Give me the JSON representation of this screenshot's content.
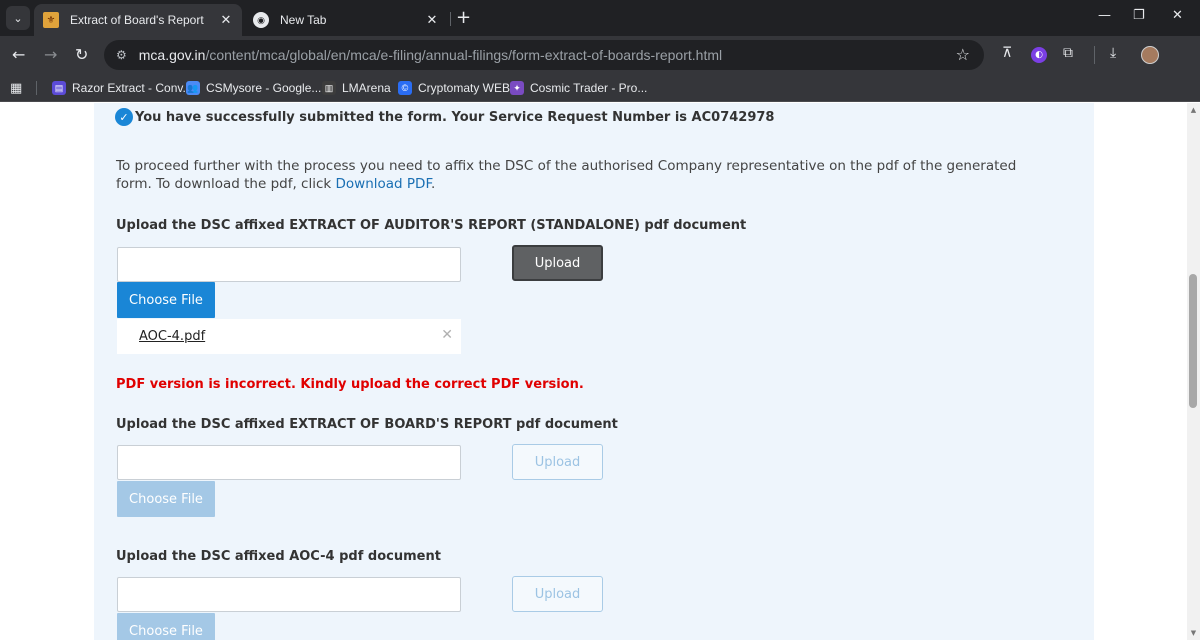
{
  "browser": {
    "tabs": [
      {
        "title": "Extract of Board's Report",
        "active": true
      },
      {
        "title": "New Tab",
        "active": false
      }
    ],
    "url_host": "mca.gov.in",
    "url_path": "/content/mca/global/en/mca/e-filing/annual-filings/form-extract-of-boards-report.html",
    "bookmarks": [
      {
        "label": "Razor Extract - Conv...",
        "color": "#5b4bd6"
      },
      {
        "label": "CSMysore - Google...",
        "color": "#4c8bf5"
      },
      {
        "label": "LMArena",
        "color": "#3c3c3c"
      },
      {
        "label": "Cryptomaty WEB",
        "color": "#2a6df4"
      },
      {
        "label": "Cosmic Trader - Pro...",
        "color": "#7a4bc2"
      }
    ]
  },
  "page": {
    "success_message": "You have successfully submitted the form. Your Service Request Number is AC0742978",
    "instruction_text": "To proceed further with the process you need to affix the DSC of the authorised Company representative on the pdf of the generated form. To download the pdf, click ",
    "download_link": "Download PDF",
    "instruction_end": ".",
    "sections": [
      {
        "label": "Upload the DSC affixed EXTRACT OF AUDITOR'S REPORT (STANDALONE) pdf document",
        "upload_label": "Upload",
        "choose_label": "Choose File",
        "file_name": "AOC-4.pdf",
        "error": "PDF version is incorrect. Kindly upload the correct PDF version.",
        "enabled": true
      },
      {
        "label": "Upload the DSC affixed EXTRACT OF BOARD'S REPORT pdf document",
        "upload_label": "Upload",
        "choose_label": "Choose File",
        "enabled": false
      },
      {
        "label": "Upload the DSC affixed AOC-4 pdf document",
        "upload_label": "Upload",
        "choose_label": "Choose File",
        "enabled": false
      }
    ]
  },
  "colors": {
    "primary": "#1a86d6",
    "error": "#e00000",
    "panel_bg": "#eef5fc"
  }
}
